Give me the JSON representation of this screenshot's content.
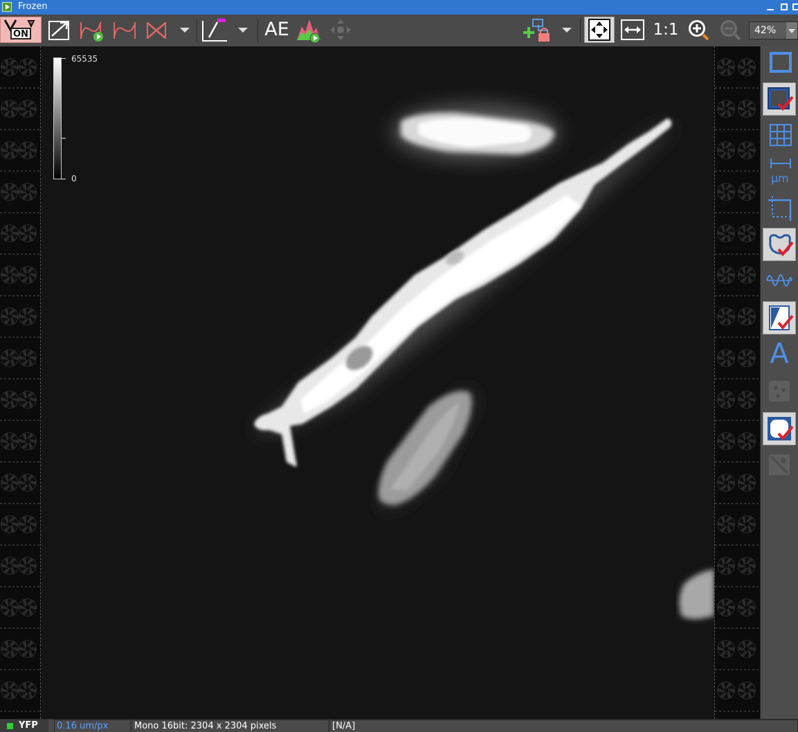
{
  "window": {
    "title": "Frozen"
  },
  "toolbar": {
    "live_toggle_label": "ON",
    "auto_exposure_label": "AE",
    "one_to_one_label": "1:1",
    "zoom_value": "42%"
  },
  "icons": {
    "live_toggle": "live-on-toggle-icon",
    "roi_arrow": "roi-arrow-icon",
    "lut_play": "lut-curve-play-icon",
    "lut_curve": "lut-curve-icon",
    "lut_reset": "lut-reset-icon",
    "line_profile": "line-profile-icon",
    "histogram_play": "histogram-play-icon",
    "pan": "pan-arrows-icon",
    "add_layer": "add-lock-layer-icon",
    "fit": "fit-to-window-icon",
    "fit_width": "fit-width-icon",
    "zoom_in": "zoom-in-icon",
    "zoom_out": "zoom-out-icon"
  },
  "viewer": {
    "calibration": {
      "max_label": "65535",
      "min_label": "0"
    }
  },
  "side_panel": [
    {
      "name": "frame-icon",
      "active": false,
      "enabled": true
    },
    {
      "name": "overlay-check-icon",
      "active": true,
      "enabled": true
    },
    {
      "name": "grid-icon",
      "active": false,
      "enabled": true
    },
    {
      "name": "scale-bar-um-icon",
      "active": false,
      "enabled": true,
      "text": "µm"
    },
    {
      "name": "crop-icon",
      "active": false,
      "enabled": true
    },
    {
      "name": "roi-check-icon",
      "active": true,
      "enabled": true
    },
    {
      "name": "waveform-icon",
      "active": false,
      "enabled": true
    },
    {
      "name": "lut-check-icon",
      "active": true,
      "enabled": true
    },
    {
      "name": "annotation-text-icon",
      "active": false,
      "enabled": true,
      "text": "A"
    },
    {
      "name": "binary-objects-icon",
      "active": false,
      "enabled": false
    },
    {
      "name": "measure-check-icon",
      "active": true,
      "enabled": true
    },
    {
      "name": "objects-disabled-icon",
      "active": false,
      "enabled": false
    }
  ],
  "status": {
    "channel": "YFP",
    "channel_color": "#36c936",
    "pixel_scale": "0.16 um/px",
    "image_format": "Mono 16bit: 2304 x 2304 pixels",
    "value": "[N/A]"
  },
  "colors": {
    "titlebar": "#2f77d0",
    "accent_blue": "#4f8fe8",
    "accent_red": "#e06666",
    "check_red": "#e0202a"
  }
}
